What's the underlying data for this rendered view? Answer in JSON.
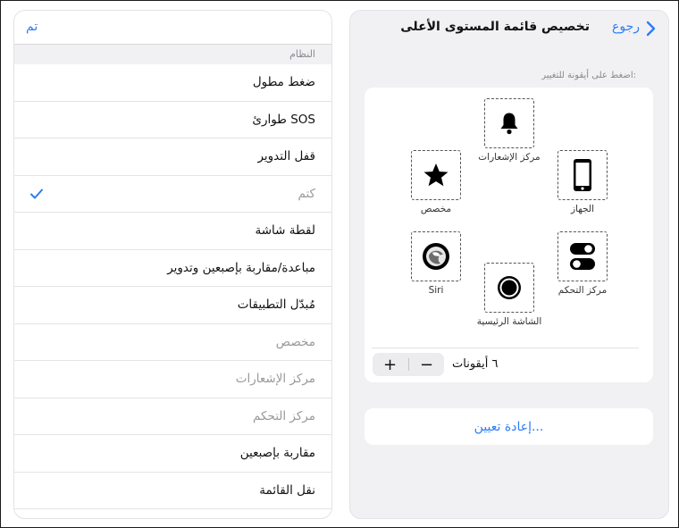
{
  "header": {
    "back_label": "رجوع",
    "title": "تخصيص قائمة المستوى الأعلى"
  },
  "hint": "اضغط على أيقونة للتغيير:",
  "slots": [
    {
      "label": "مركز الإشعارات",
      "icon": "bell-icon"
    },
    {
      "label": "الجهاز",
      "icon": "iphone-device-icon"
    },
    {
      "label": "مخصص",
      "icon": "star-icon"
    },
    {
      "label": "مركز التحكم",
      "icon": "toggles-icon"
    },
    {
      "label": "Siri",
      "icon": "siri-icon"
    },
    {
      "label": "الشاشة الرئيسية",
      "icon": "home-button-icon"
    }
  ],
  "stepper": {
    "plus": "+",
    "minus": "−"
  },
  "icon_count": "٦ أيقونات",
  "reset_label": "إعادة تعيين...",
  "list": {
    "done_label": "تم",
    "section_header": "النظام",
    "items": [
      {
        "label": "ضغط مطول",
        "disabled": false,
        "checked": false
      },
      {
        "label": "طوارئ SOS",
        "disabled": false,
        "checked": false
      },
      {
        "label": "قفل التدوير",
        "disabled": false,
        "checked": false
      },
      {
        "label": "كتم",
        "disabled": true,
        "checked": true
      },
      {
        "label": "لقطة شاشة",
        "disabled": false,
        "checked": false
      },
      {
        "label": "مباعدة/مقاربة بإصبعين وتدوير",
        "disabled": false,
        "checked": false
      },
      {
        "label": "مُبدّل التطبيقات",
        "disabled": false,
        "checked": false
      },
      {
        "label": "مخصص",
        "disabled": true,
        "checked": false
      },
      {
        "label": "مركز الإشعارات",
        "disabled": true,
        "checked": false
      },
      {
        "label": "مركز التحكم",
        "disabled": true,
        "checked": false
      },
      {
        "label": "مقاربة بإصبعين",
        "disabled": false,
        "checked": false
      },
      {
        "label": "نقل القائمة",
        "disabled": false,
        "checked": false
      }
    ]
  },
  "colors": {
    "accent": "#2e7cf6",
    "panel_bg": "#f1f1f4",
    "disabled_text": "#9a9a9e"
  }
}
